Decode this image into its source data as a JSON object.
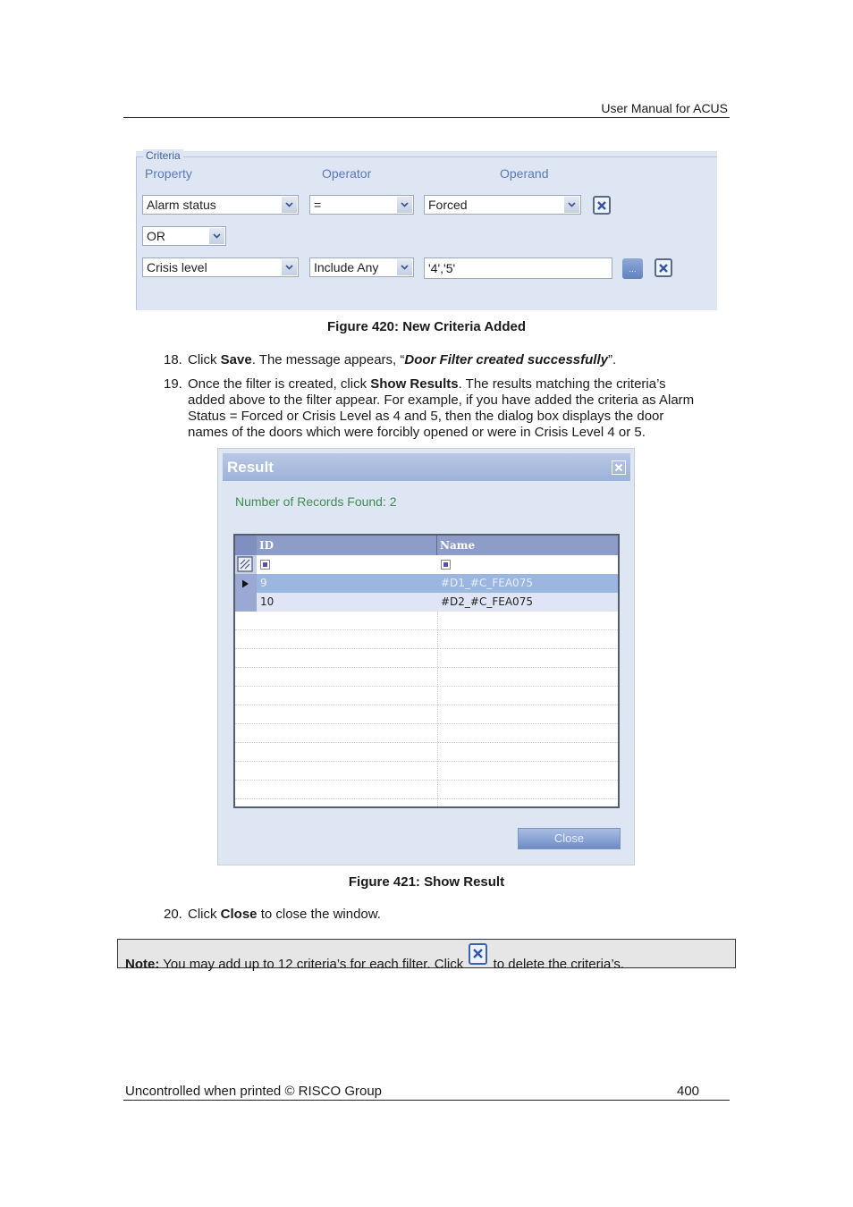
{
  "header": {
    "title": "User Manual for ACUS"
  },
  "criteria_panel": {
    "legend": "Criteria",
    "columns": {
      "property": "Property",
      "operator": "Operator",
      "operand": "Operand"
    },
    "rows": [
      {
        "property": "Alarm status",
        "operator": "=",
        "operand": "Forced"
      },
      {
        "property": "Crisis level",
        "operator": "Include Any",
        "operand": "'4','5'"
      }
    ],
    "conjunction": "OR",
    "browse_label": "...",
    "icons": {
      "dropdown": "chevron-down-icon",
      "delete": "close-x-icon"
    }
  },
  "figure_420": {
    "caption": "Figure 420: New Criteria Added"
  },
  "steps": [
    {
      "number": "18.",
      "parts": [
        {
          "text": "Click "
        },
        {
          "text": "Save",
          "bold": true
        },
        {
          "text": ". The message appears, “"
        },
        {
          "text": "Door Filter created successfully",
          "bold": true,
          "italic": true
        },
        {
          "text": "”."
        }
      ]
    },
    {
      "number": "19.",
      "lines": [
        "Once the filter is created, click ",
        "Show Results",
        ". The results matching the criteria’s",
        "added above to the filter appear. For example, if you have added the criteria as Alarm",
        "Status = Forced or Crisis Level as 4 and 5, then the dialog box displays the door",
        "names of the doors which were forcibly opened or were in Crisis Level 4 or 5."
      ]
    },
    {
      "number": "20.",
      "parts": [
        {
          "text": "Click "
        },
        {
          "text": "Close",
          "bold": true
        },
        {
          "text": " to close the window."
        }
      ]
    }
  ],
  "result_dialog": {
    "title": "Result",
    "records_found": "Number of Records Found: 2",
    "grid": {
      "columns": [
        "ID",
        "Name"
      ],
      "rows": [
        {
          "id": "9",
          "name": "#D1_#C_FEA075",
          "selected": true
        },
        {
          "id": "10",
          "name": "#D2_#C_FEA075",
          "selected": false
        }
      ]
    },
    "close_label": "Close",
    "colors": {
      "title_bar": "#9cb2d8",
      "records_text": "#3c8f4e",
      "selected_row": "#9bb7e0"
    }
  },
  "figure_421": {
    "caption": "Figure 421: Show Result"
  },
  "note": {
    "label": "Note:",
    "text_before": " You may add up to 12 criteria’s for each filter. Click",
    "text_after": "to delete the criteria’s."
  },
  "footer": {
    "text": "Uncontrolled when printed © RISCO Group",
    "page": "400"
  }
}
